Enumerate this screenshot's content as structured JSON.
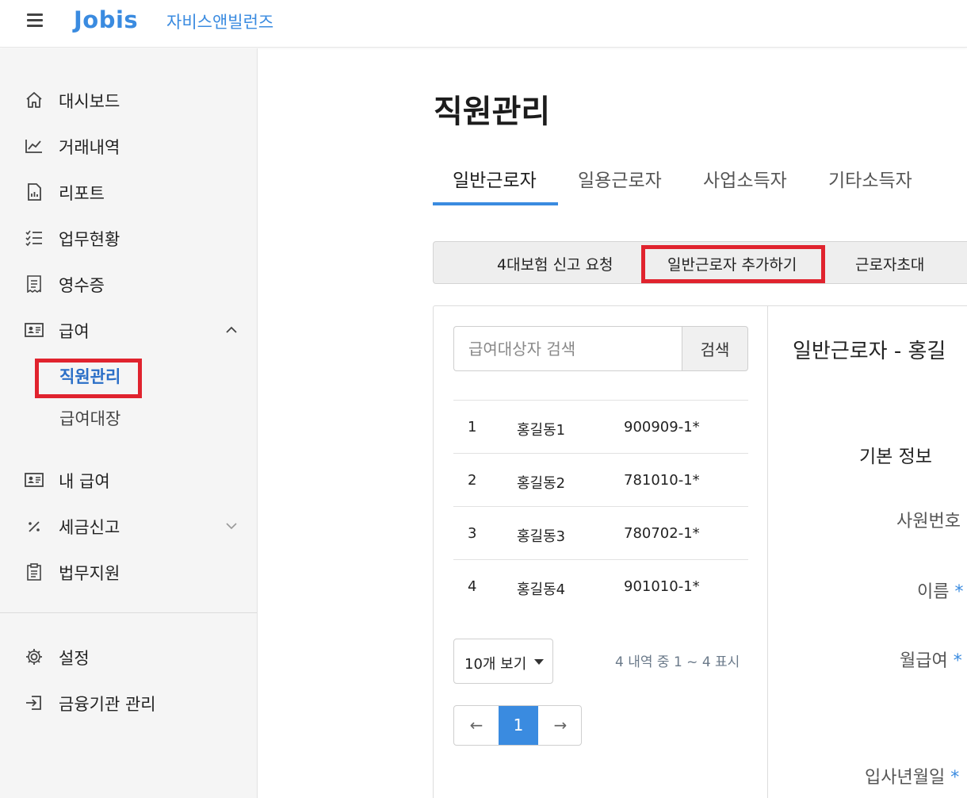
{
  "header": {
    "logo": "Jobis",
    "company": "자비스앤빌런즈"
  },
  "sidebar": {
    "items": [
      {
        "label": "대시보드",
        "icon": "home-icon"
      },
      {
        "label": "거래내역",
        "icon": "chart-line-icon"
      },
      {
        "label": "리포트",
        "icon": "report-icon"
      },
      {
        "label": "업무현황",
        "icon": "checklist-icon"
      },
      {
        "label": "영수증",
        "icon": "receipt-icon"
      },
      {
        "label": "급여",
        "icon": "id-card-icon",
        "expanded": true
      },
      {
        "label": "내 급여",
        "icon": "id-card-icon"
      },
      {
        "label": "세금신고",
        "icon": "percent-icon",
        "expanded": false
      },
      {
        "label": "법무지원",
        "icon": "clipboard-icon"
      }
    ],
    "sub_items": [
      {
        "label": "직원관리",
        "active": true
      },
      {
        "label": "급여대장",
        "active": false
      }
    ],
    "bottom_items": [
      {
        "label": "설정",
        "icon": "gear-icon"
      },
      {
        "label": "금융기관 관리",
        "icon": "sign-in-icon"
      }
    ]
  },
  "main": {
    "title": "직원관리",
    "tabs": [
      {
        "label": "일반근로자",
        "active": true
      },
      {
        "label": "일용근로자",
        "active": false
      },
      {
        "label": "사업소득자",
        "active": false
      },
      {
        "label": "기타소득자",
        "active": false
      }
    ],
    "actions": [
      {
        "label": "4대보험 신고 요청"
      },
      {
        "label": "일반근로자 추가하기",
        "highlighted": true
      },
      {
        "label": "근로자초대"
      }
    ]
  },
  "list": {
    "search_placeholder": "급여대상자 검색",
    "search_button": "검색",
    "rows": [
      {
        "no": "1",
        "name": "홍길동1",
        "id": "900909-1*"
      },
      {
        "no": "2",
        "name": "홍길동2",
        "id": "781010-1*"
      },
      {
        "no": "3",
        "name": "홍길동3",
        "id": "780702-1*"
      },
      {
        "no": "4",
        "name": "홍길동4",
        "id": "901010-1*"
      }
    ],
    "page_size": "10개 보기",
    "page_info": "4 내역 중 1 ~ 4 표시",
    "pager": {
      "prev": "←",
      "current": "1",
      "next": "→"
    }
  },
  "detail": {
    "title": "일반근로자 - 홍길",
    "section": "기본 정보",
    "fields": [
      {
        "label": "사원번호",
        "required": ""
      },
      {
        "label": "이름",
        "required": "*"
      },
      {
        "label": "월급여",
        "required": "*"
      },
      {
        "label": "입사년월일",
        "required": "*"
      }
    ]
  },
  "colors": {
    "accent": "#3a8be0",
    "highlight_border": "#e0232e",
    "sidebar_bg": "#f5f5f5"
  }
}
